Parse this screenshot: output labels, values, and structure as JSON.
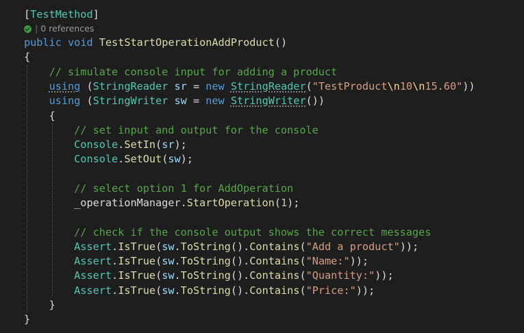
{
  "colors": {
    "background": "#1e1e1e",
    "keyword": "#569cd6",
    "type": "#4ec9b0",
    "method": "#dcdcaa",
    "string": "#d69d85",
    "comment": "#57a64a",
    "plain": "#dcdcdc"
  },
  "codelens": {
    "status_icon": "check-circle-icon",
    "separator": "|",
    "references": "0 references"
  },
  "code": {
    "attr_open": "[",
    "attr_name": "TestMethod",
    "attr_close": "]",
    "kw_public": "public",
    "kw_void": "void",
    "method_name": "TestStartOperationAddProduct",
    "parens": "()",
    "brace_open": "{",
    "brace_close": "}",
    "comment1": "// simulate console input for adding a product",
    "kw_using": "using",
    "paren_open": "(",
    "type_string_reader": "StringReader",
    "var_sr": "sr",
    "eq": "=",
    "kw_new": "new",
    "str_sr_1": "\"TestProduct",
    "esc_n": "\\n",
    "str_sr_2": "10",
    "str_sr_3": "15.60\"",
    "close_paren_2": "))",
    "type_string_writer": "StringWriter",
    "var_sw": "sw",
    "close_paren_3": "()",
    "close_paren_single": ")",
    "comment2": "// set input and output for the console",
    "type_console": "Console",
    "dot": ".",
    "method_setin": "SetIn",
    "method_setout": "SetOut",
    "close_stmt": ");",
    "comment3": "// select option 1 for AddOperation",
    "var_op_manager": "_operationManager",
    "method_start_op": "StartOperation",
    "num_1": "1",
    "comment4": "// check if the console output shows the correct messages",
    "type_assert": "Assert",
    "method_istrue": "IsTrue",
    "method_tostring": "ToString",
    "method_contains": "Contains",
    "str_add": "\"Add a product\"",
    "str_name": "\"Name:\"",
    "str_quantity": "\"Quantity:\"",
    "str_price": "\"Price:\"",
    "close_assert": "));"
  }
}
